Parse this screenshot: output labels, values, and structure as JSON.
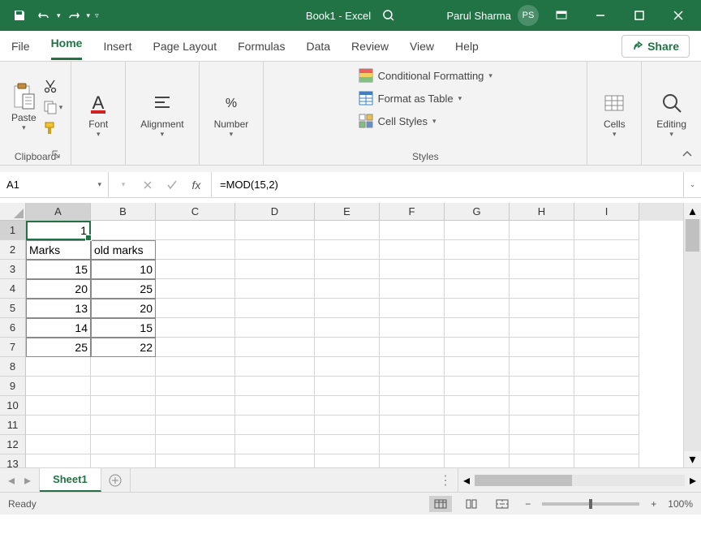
{
  "title": "Book1 - Excel",
  "user": {
    "name": "Parul Sharma",
    "initials": "PS"
  },
  "tabs": {
    "file": "File",
    "home": "Home",
    "insert": "Insert",
    "layout": "Page Layout",
    "formulas": "Formulas",
    "data": "Data",
    "review": "Review",
    "view": "View",
    "help": "Help"
  },
  "share_label": "Share",
  "ribbon": {
    "clipboard": {
      "title": "Clipboard",
      "paste": "Paste"
    },
    "font": {
      "title": "Font"
    },
    "alignment": {
      "title": "Alignment"
    },
    "number": {
      "title": "Number"
    },
    "styles": {
      "title": "Styles",
      "conditional": "Conditional Formatting",
      "table": "Format as Table",
      "cellstyles": "Cell Styles"
    },
    "cells": {
      "title": "Cells"
    },
    "editing": {
      "title": "Editing"
    }
  },
  "formula_bar": {
    "name_box": "A1",
    "fx": "fx",
    "formula": "=MOD(15,2)"
  },
  "columns": [
    "A",
    "B",
    "C",
    "D",
    "E",
    "F",
    "G",
    "H",
    "I"
  ],
  "cells": {
    "A1": "1",
    "A2": "Marks",
    "B2": "old marks",
    "A3": "15",
    "B3": "10",
    "A4": "20",
    "B4": "25",
    "A5": "13",
    "B5": "20",
    "A6": "14",
    "B6": "15",
    "A7": "25",
    "B7": "22"
  },
  "sheet": {
    "name": "Sheet1"
  },
  "status": {
    "ready": "Ready",
    "zoom": "100%"
  }
}
